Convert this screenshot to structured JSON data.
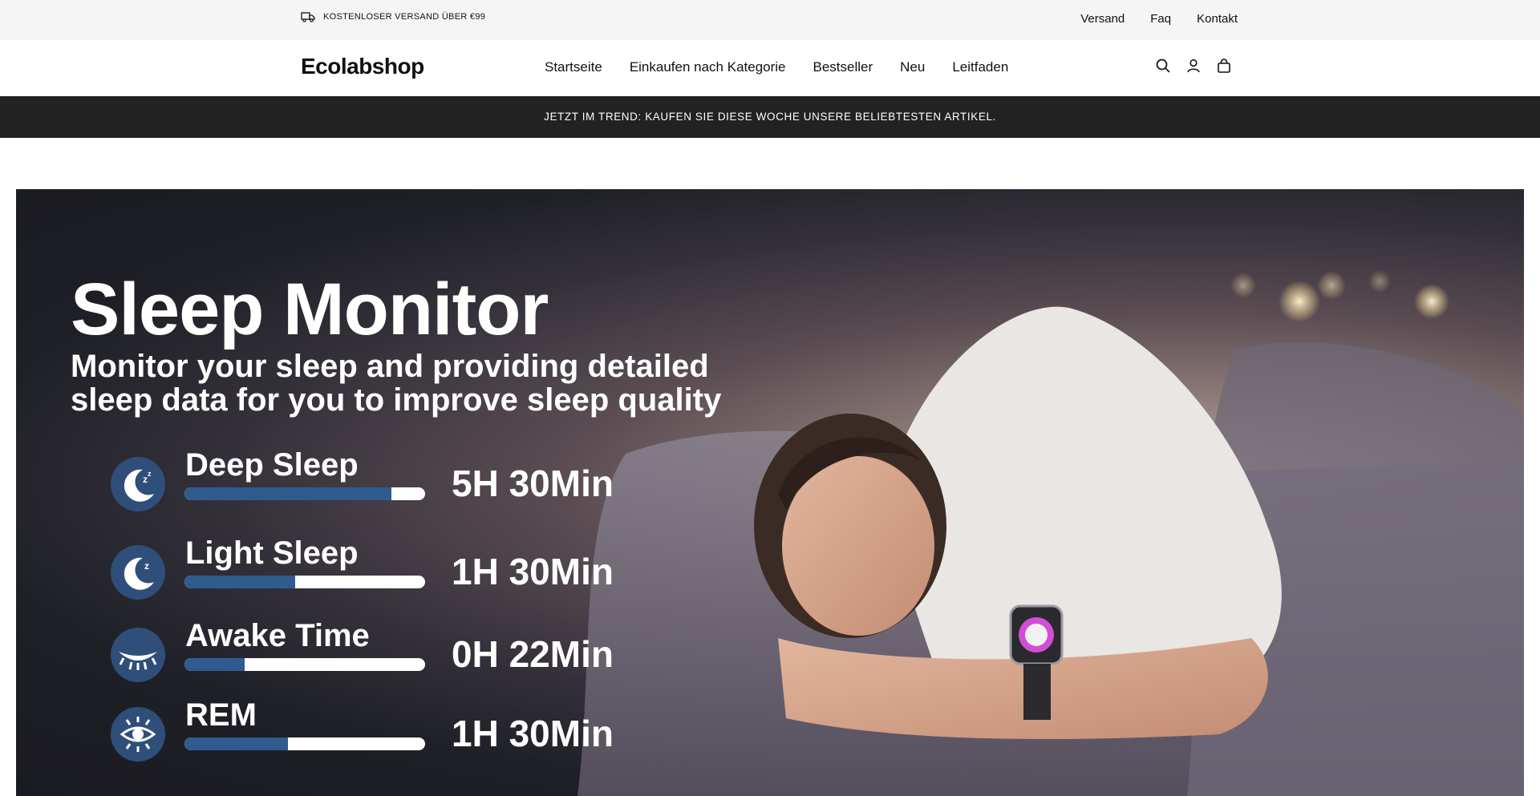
{
  "topbar": {
    "shipping_text": "KOSTENLOSER VERSAND ÜBER €99",
    "links": [
      "Versand",
      "Faq",
      "Kontakt"
    ]
  },
  "header": {
    "logo": "Ecolabshop",
    "nav": [
      "Startseite",
      "Einkaufen nach Kategorie",
      "Bestseller",
      "Neu",
      "Leitfaden"
    ],
    "icons": [
      "search-icon",
      "account-icon",
      "cart-icon"
    ]
  },
  "trend_banner": "JETZT IM TREND: KAUFEN SIE DIESE WOCHE UNSERE BELIEBTESTEN ARTIKEL.",
  "hero": {
    "title": "Sleep Monitor",
    "subtitle": "Monitor your sleep and providing detailed sleep data for you to improve sleep quality",
    "stats": [
      {
        "label": "Deep Sleep",
        "value": "5H 30Min",
        "fill": 0.86,
        "icon": "moon-sleep-icon"
      },
      {
        "label": "Light Sleep",
        "value": "1H 30Min",
        "fill": 0.46,
        "icon": "moon-sleep-icon"
      },
      {
        "label": "Awake Time",
        "value": "0H 22Min",
        "fill": 0.25,
        "icon": "closed-eye-icon"
      },
      {
        "label": "REM",
        "value": "1H 30Min",
        "fill": 0.43,
        "icon": "eye-icon"
      }
    ],
    "colors": {
      "badge": "#2f4f7a",
      "bar_fill": "#2f5b8f"
    }
  }
}
